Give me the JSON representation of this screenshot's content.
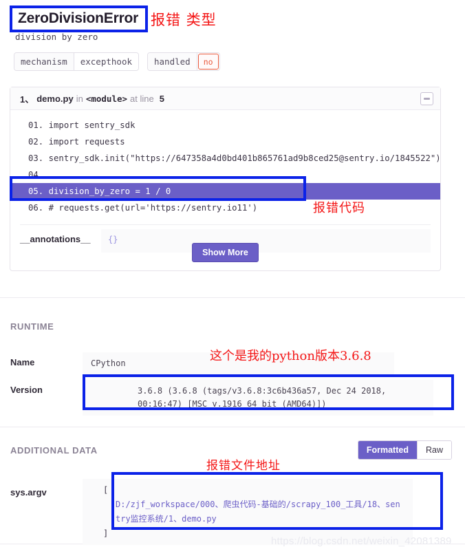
{
  "error": {
    "type": "ZeroDivisionError",
    "message": "division by zero"
  },
  "tags": [
    {
      "key": "mechanism",
      "value": "excepthook",
      "danger": false
    },
    {
      "key": "handled",
      "value": "no",
      "danger": true
    }
  ],
  "frame": {
    "index": "1、",
    "filename": "demo.py",
    "in_word": "in",
    "module": "<module>",
    "at_text": "at line",
    "line_number": "5",
    "collapse_icon": "minus-icon",
    "code_lines": [
      {
        "num": "01.",
        "text": "import sentry_sdk",
        "active": false
      },
      {
        "num": "02.",
        "text": "import requests",
        "active": false
      },
      {
        "num": "03.",
        "text": "sentry_sdk.init(\"https://647358a4d0bd401b865761ad9b8ced25@sentry.io/1845522\")",
        "active": false
      },
      {
        "num": "04",
        "text": "",
        "active": false
      },
      {
        "num": "05.",
        "text": "division_by_zero = 1 / 0",
        "active": true
      },
      {
        "num": "06.",
        "text": "# requests.get(url='https://sentry.io11')",
        "active": false
      }
    ],
    "vars": [
      {
        "key": "__annotations__",
        "value": "{}"
      }
    ],
    "show_more_label": "Show More"
  },
  "runtime": {
    "section_title": "RUNTIME",
    "name_label": "Name",
    "name_value": "CPython",
    "version_label": "Version",
    "version_value": "3.6.8 (3.6.8 (tags/v3.6.8:3c6b436a57, Dec 24 2018, 00:16:47) [MSC v.1916 64 bit (AMD64)])"
  },
  "additional_data": {
    "section_title": "ADDITIONAL DATA",
    "toggle": {
      "formatted": "Formatted",
      "raw": "Raw"
    },
    "key_label": "sys.argv",
    "open_bracket": "[",
    "path": "D:/zjf_workspace/000、爬虫代码-基础的/scrapy_100_工具/18、sentry监控系统/1、demo.py",
    "close_bracket": "]"
  },
  "annotations": {
    "error_type": "报错 类型",
    "error_code": "报错代码",
    "python_version": "这个是我的python版本3.6.8",
    "file_path": "报错文件地址",
    "highlight_color": "#0b22e8",
    "text_color": "#f41616"
  },
  "watermark": "https://blog.csdn.net/weixin_42081389",
  "theme": {
    "accent": "#6b5fc7",
    "danger": "#e8583b",
    "muted": "#9993a1"
  }
}
